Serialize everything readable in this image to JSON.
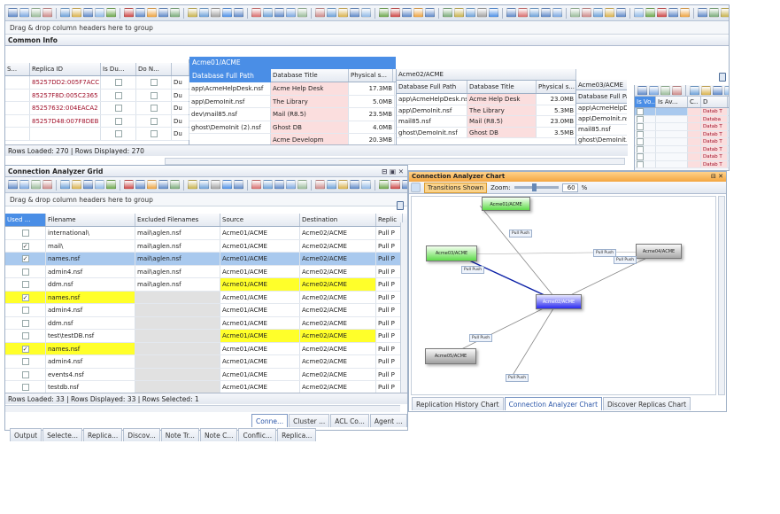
{
  "top": {
    "group_hint": "Drag & drop column headers here to group",
    "title": "Common Info",
    "columns": [
      "S...",
      "Replica ID",
      "Is Du...",
      "Do N..."
    ],
    "replica_ids": [
      "85257DD2:005F7ACC",
      "85257F8D:005C2365",
      "85257632:004EACA2",
      "85257D48:007F8DEB"
    ],
    "col_du": [
      "Du",
      "Du",
      "Du",
      "Du",
      "Du"
    ],
    "status": "Rows Loaded: 270  |  Rows Displayed: 270",
    "server1": {
      "name": "Acme01/ACME",
      "sub_header": "Database Full Path",
      "title_header": "Database Title",
      "size_header": "Physical s...",
      "paths": [
        "app\\AcmeHelpDesk.nsf",
        "app\\DemoInit.nsf",
        "dev\\mail85.nsf",
        "ghost\\DemoInit (2).nsf"
      ],
      "titles": [
        "Acme Help Desk",
        "The Library",
        "Mail (R8.5)",
        "Ghost DB",
        "Acme Developm"
      ],
      "sizes": [
        "17.3MB",
        "5.0MB",
        "23.5MB",
        "4.0MB",
        "20.3MB"
      ]
    },
    "server2": {
      "name": "Acme02/ACME",
      "path_header": "Database Full Path",
      "title_header": "Database Title",
      "size_header": "Physical s...",
      "paths": [
        "app\\AcmeHelpDesk.nsf",
        "app\\DemoInit.nsf",
        "mail85.nsf",
        "ghost\\DemoInit.nsf"
      ],
      "titles": [
        "Acme Help Desk",
        "The Library",
        "Mail (R8.5)",
        "Ghost DB"
      ],
      "sizes": [
        "23.0MB",
        "5.3MB",
        "23.0MB",
        "3.5MB"
      ]
    },
    "server3": {
      "name": "Acme03/ACME",
      "path_header": "Database Full Path",
      "paths": [
        "app\\AcmeHelpDesk.nsf",
        "app\\DemoInit.nsf",
        "mail85.nsf",
        "ghost\\DemoInit.nsf"
      ]
    },
    "side": {
      "columns": [
        "Is Vo...",
        "Is Av...",
        "C..",
        "D"
      ],
      "items": [
        "Datab T",
        "Databa",
        "Datab T",
        "Datab T",
        "Datab T",
        "Datab T",
        "Datab T",
        "Datab T"
      ]
    }
  },
  "grid": {
    "title": "Connection Analyzer Grid",
    "group_hint": "Drag & drop column headers here to group",
    "columns": [
      "Used ...",
      "Filename",
      "Excluded Filenames",
      "Source",
      "Destination",
      "Replic"
    ],
    "rows": [
      {
        "filename": "international\\",
        "excluded": "mail\\aglen.nsf",
        "source": "Acme01/ACME",
        "dest": "Acme02/ACME",
        "rep": "Pull P"
      },
      {
        "filename": "mail\\",
        "excluded": "mail\\aglen.nsf",
        "source": "Acme01/ACME",
        "dest": "Acme02/ACME",
        "rep": "Pull P"
      },
      {
        "filename": "names.nsf",
        "excluded": "mail\\aglen.nsf",
        "source": "Acme01/ACME",
        "dest": "Acme02/ACME",
        "rep": "Pull P"
      },
      {
        "filename": "admin4.nsf",
        "excluded": "mail\\aglen.nsf",
        "source": "Acme01/ACME",
        "dest": "Acme02/ACME",
        "rep": "Pull P"
      },
      {
        "filename": "ddm.nsf",
        "excluded": "mail\\aglen.nsf",
        "source": "Acme01/ACME",
        "dest": "Acme02/ACME",
        "rep": "Pull P"
      },
      {
        "filename": "names.nsf",
        "excluded": "",
        "source": "Acme01/ACME",
        "dest": "Acme02/ACME",
        "rep": "Pull P"
      },
      {
        "filename": "admin4.nsf",
        "excluded": "",
        "source": "Acme01/ACME",
        "dest": "Acme02/ACME",
        "rep": "Pull P"
      },
      {
        "filename": "ddm.nsf",
        "excluded": "",
        "source": "Acme01/ACME",
        "dest": "Acme02/ACME",
        "rep": "Pull P"
      },
      {
        "filename": "test\\testDB.nsf",
        "excluded": "",
        "source": "Acme01/ACME",
        "dest": "Acme02/ACME",
        "rep": "Pull P"
      },
      {
        "filename": "names.nsf",
        "excluded": "",
        "source": "Acme01/ACME",
        "dest": "Acme02/ACME",
        "rep": "Pull P"
      },
      {
        "filename": "admin4.nsf",
        "excluded": "",
        "source": "Acme01/ACME",
        "dest": "Acme02/ACME",
        "rep": "Pull P"
      },
      {
        "filename": "events4.nsf",
        "excluded": "",
        "source": "Acme01/ACME",
        "dest": "Acme02/ACME",
        "rep": "Pull P"
      },
      {
        "filename": "testdb.nsf",
        "excluded": "",
        "source": "Acme01/ACME",
        "dest": "Acme02/ACME",
        "rep": "Pull P"
      }
    ],
    "status": "Rows Loaded: 33  |  Rows Displayed: 33  |  Rows Selected: 1"
  },
  "chart_panel": {
    "title": "Connection Analyzer Chart",
    "transitions_label": "Transitions Shown",
    "zoom_label": "Zoom:",
    "zoom_value": "60",
    "zoom_unit": "%",
    "nodes": [
      "Acme01/ACME",
      "Acme02/ACME",
      "Acme03/ACME",
      "Acme04/ACME",
      "Acme05/ACME"
    ],
    "edge_label": "Pull Push",
    "tabs": [
      "Replication History Chart",
      "Connection Analyzer Chart",
      "Discover Replicas Chart"
    ]
  },
  "bottom_tabs": [
    "Conne...",
    "Cluster ...",
    "ACL Co...",
    "Agent ..."
  ],
  "bottom_tabs_left": [
    "Output",
    "Selecte...",
    "Replica...",
    "Discov...",
    "Note Tr...",
    "Note C...",
    "Conflic...",
    "Replica..."
  ]
}
